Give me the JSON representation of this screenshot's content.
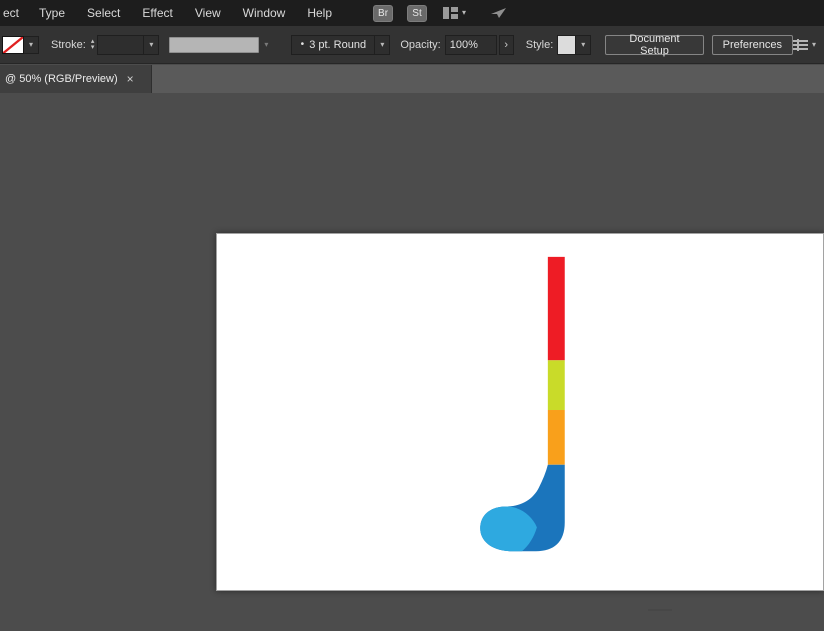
{
  "menu_bar": {
    "items": [
      {
        "label": "ect"
      },
      {
        "label": "Type"
      },
      {
        "label": "Select"
      },
      {
        "label": "Effect"
      },
      {
        "label": "View"
      },
      {
        "label": "Window"
      },
      {
        "label": "Help"
      }
    ],
    "bridge_badge": "Br",
    "stock_badge": "St"
  },
  "control_bar": {
    "stroke_label": "Stroke:",
    "brush_bullet": "•",
    "brush_label": "3 pt. Round",
    "opacity_label": "Opacity:",
    "opacity_value": "100%",
    "style_label": "Style:",
    "document_setup_label": "Document Setup",
    "preferences_label": "Preferences"
  },
  "tab_bar": {
    "active_tab_label": "@ 50% (RGB/Preview)"
  },
  "icons": {
    "chevron_down": "▾",
    "chevron_up": "▴",
    "chevron_right": "›",
    "close": "×"
  },
  "artboard": {
    "stick_colors": {
      "red": "#EE1C25",
      "lime": "#C9DB29",
      "orange": "#F9A01B",
      "dark_blue": "#1B75BC",
      "light_blue": "#2EA9E0"
    },
    "no_stroke_color": "#E02020"
  }
}
